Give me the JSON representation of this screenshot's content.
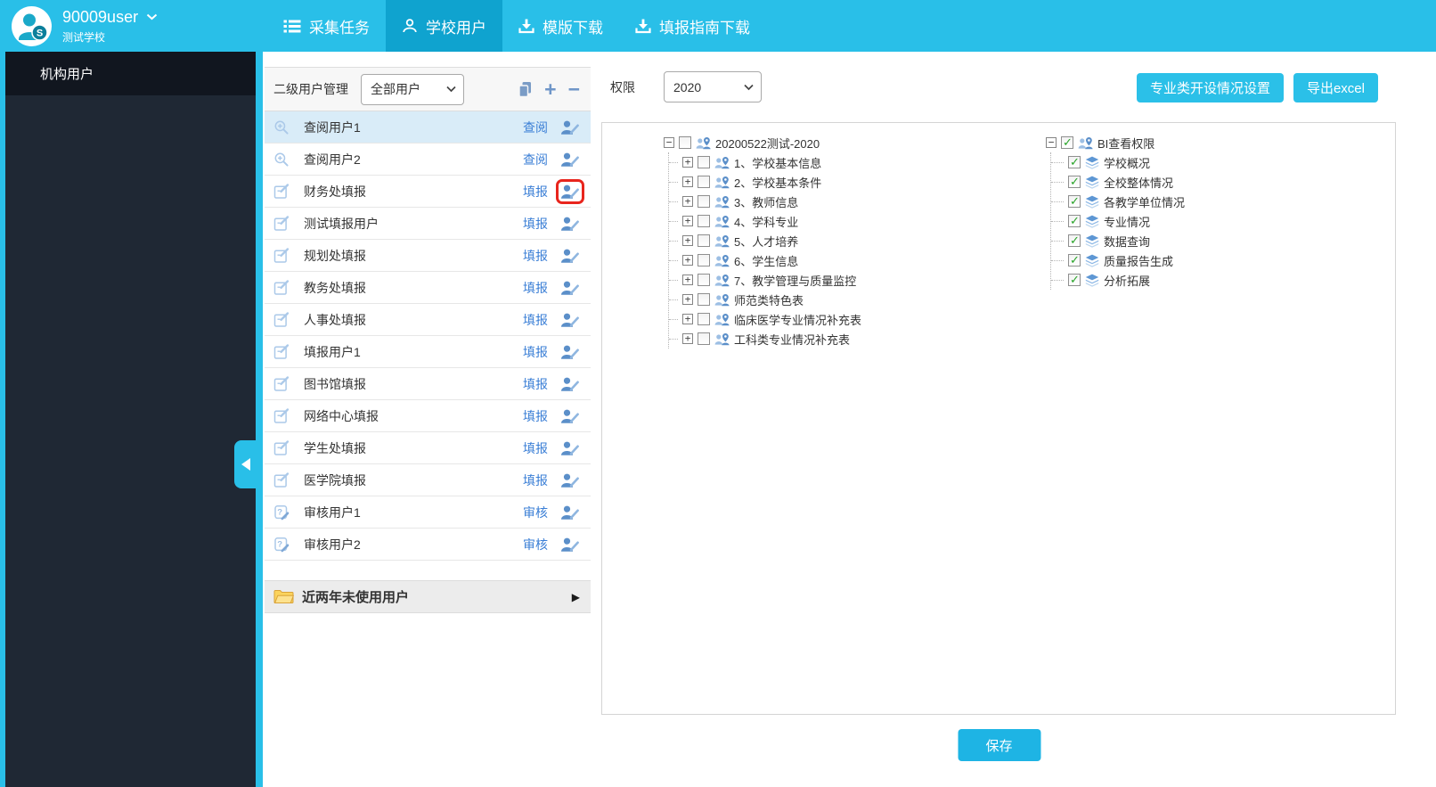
{
  "header": {
    "username": "90009user",
    "school": "测试学校",
    "nav": [
      {
        "label": "采集任务",
        "icon": "list-icon",
        "active": false
      },
      {
        "label": "学校用户",
        "icon": "user-icon",
        "active": true
      },
      {
        "label": "模版下载",
        "icon": "download-icon",
        "active": false
      },
      {
        "label": "填报指南下载",
        "icon": "download-icon",
        "active": false
      }
    ]
  },
  "sidebar": {
    "items": [
      {
        "label": "机构用户",
        "active": true
      }
    ]
  },
  "user_panel": {
    "title": "二级用户管理",
    "filter_value": "全部用户",
    "toolbar_icons": [
      "copy-icon",
      "add-icon",
      "remove-icon"
    ],
    "users": [
      {
        "name": "查阅用户1",
        "role": "查阅",
        "type": "view",
        "selected": true
      },
      {
        "name": "查阅用户2",
        "role": "查阅",
        "type": "view"
      },
      {
        "name": "财务处填报",
        "role": "填报",
        "type": "fill",
        "highlighted_edit": true
      },
      {
        "name": "测试填报用户",
        "role": "填报",
        "type": "fill"
      },
      {
        "name": "规划处填报",
        "role": "填报",
        "type": "fill"
      },
      {
        "name": "教务处填报",
        "role": "填报",
        "type": "fill"
      },
      {
        "name": "人事处填报",
        "role": "填报",
        "type": "fill"
      },
      {
        "name": "填报用户1",
        "role": "填报",
        "type": "fill"
      },
      {
        "name": "图书馆填报",
        "role": "填报",
        "type": "fill"
      },
      {
        "name": "网络中心填报",
        "role": "填报",
        "type": "fill"
      },
      {
        "name": "学生处填报",
        "role": "填报",
        "type": "fill"
      },
      {
        "name": "医学院填报",
        "role": "填报",
        "type": "fill"
      },
      {
        "name": "审核用户1",
        "role": "审核",
        "type": "audit"
      },
      {
        "name": "审核用户2",
        "role": "审核",
        "type": "audit"
      }
    ],
    "unused_label": "近两年未使用用户"
  },
  "permission_panel": {
    "label": "权限",
    "year_value": "2020",
    "settings_button": "专业类开设情况设置",
    "export_button": "导出excel",
    "save_button": "保存",
    "form_tree": {
      "root_label": "20200522测试-2020",
      "root_checked": false,
      "children": [
        "1、学校基本信息",
        "2、学校基本条件",
        "3、教师信息",
        "4、学科专业",
        "5、人才培养",
        "6、学生信息",
        "7、教学管理与质量监控",
        "师范类特色表",
        "临床医学专业情况补充表",
        "工科类专业情况补充表"
      ]
    },
    "bi_tree": {
      "root_label": "BI查看权限",
      "root_checked": true,
      "children": [
        "学校概况",
        "全校整体情况",
        "各教学单位情况",
        "专业情况",
        "数据查询",
        "质量报告生成",
        "分析拓展"
      ]
    }
  },
  "colors": {
    "accent": "#29bfe8",
    "accent_active_tab": "#0fa3cf",
    "link_blue": "#3b7fd6",
    "highlight_red": "#e8251d",
    "sidebar_dark": "#1f2834",
    "sidebar_item_dark": "#11161f",
    "selected_row": "#d9ecf8",
    "check_green": "#28a428"
  }
}
